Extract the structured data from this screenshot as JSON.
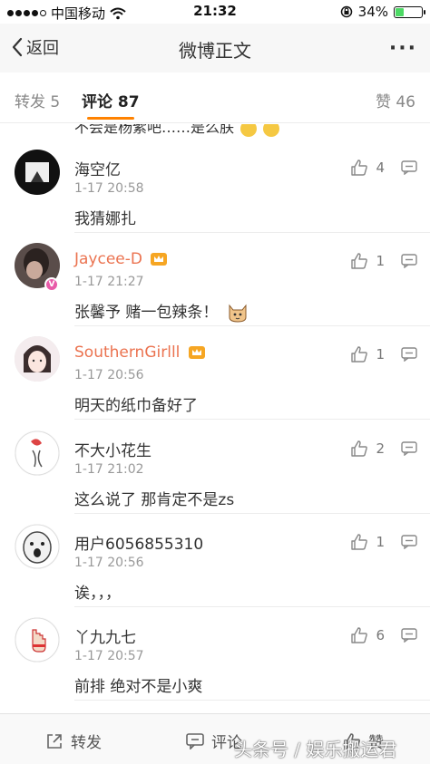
{
  "status_bar": {
    "carrier": "中国移动",
    "time": "21:32",
    "battery": "34%",
    "battery_level": 0.34
  },
  "nav": {
    "back_label": "返回",
    "title": "微博正文",
    "more_label": "···"
  },
  "tabs": {
    "repost": "转发 5",
    "comments": "评论 87",
    "likes": "赞 46"
  },
  "partial_comment_text": "不会是杨紫吧……是么朕",
  "comments": [
    {
      "name": "海空亿",
      "time": "1-17 20:58",
      "text": "我猜娜扎",
      "likes": "4",
      "vip": false
    },
    {
      "name": "Jaycee-D",
      "time": "1-17 21:27",
      "text": "张馨予 赌一包辣条！",
      "likes": "1",
      "vip": true
    },
    {
      "name": "SouthernGirlll",
      "time": "1-17 20:56",
      "text": "明天的纸巾备好了",
      "likes": "1",
      "vip": true
    },
    {
      "name": "不大小花生",
      "time": "1-17 21:02",
      "text": "这么说了  那肯定不是zs",
      "likes": "2",
      "vip": false
    },
    {
      "name": "用户6056855310",
      "time": "1-17 20:56",
      "text": "诶，，，",
      "likes": "1",
      "vip": false
    },
    {
      "name": "丫九九七",
      "time": "1-17 20:57",
      "text": "前排  绝对不是小爽",
      "likes": "6",
      "vip": false
    }
  ],
  "bottom_bar": {
    "repost": "转发",
    "comment": "评论",
    "like": "赞"
  },
  "watermark": "头条号 / 娱乐搬运君",
  "colors": {
    "accent": "#ff8200",
    "vip_name": "#eb7350",
    "battery": "#4cd964"
  }
}
